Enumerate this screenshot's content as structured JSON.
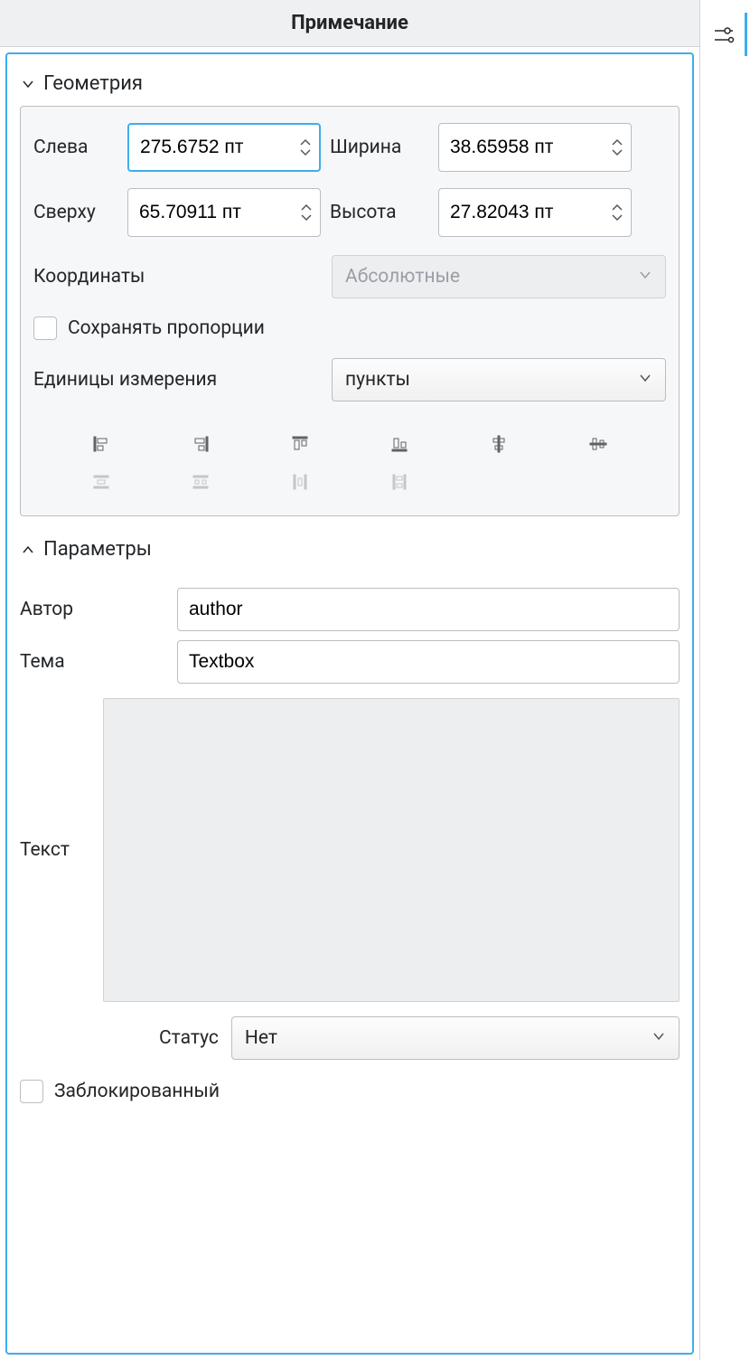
{
  "header": {
    "title": "Примечание"
  },
  "geometry": {
    "section_label": "Геометрия",
    "left_label": "Слева",
    "left_value": "275.6752 пт",
    "top_label": "Сверху",
    "top_value": "65.70911 пт",
    "width_label": "Ширина",
    "width_value": "38.65958 пт",
    "height_label": "Высота",
    "height_value": "27.82043 пт",
    "coords_label": "Координаты",
    "coords_value": "Абсолютные",
    "keep_ratio_label": "Сохранять пропорции",
    "units_label": "Единицы измерения",
    "units_value": "пункты"
  },
  "parameters": {
    "section_label": "Параметры",
    "author_label": "Автор",
    "author_value": "author",
    "subject_label": "Тема",
    "subject_value": "Textbox",
    "text_label": "Текст",
    "status_label": "Статус",
    "status_value": "Нет",
    "locked_label": "Заблокированный"
  }
}
